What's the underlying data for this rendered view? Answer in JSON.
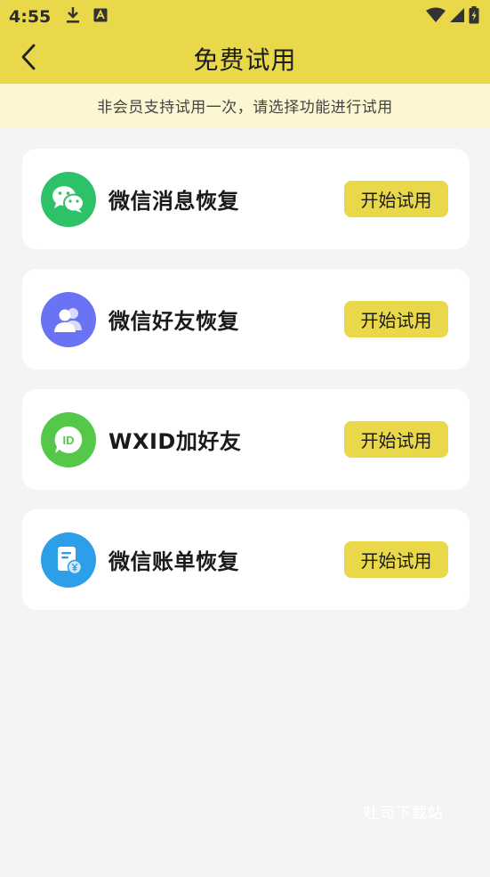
{
  "status_bar": {
    "time": "4:55",
    "icons_left": [
      "download-icon",
      "app-a-icon"
    ],
    "icons_right": [
      "wifi-icon",
      "signal-icon",
      "battery-icon"
    ]
  },
  "header": {
    "title": "免费试用",
    "back_icon": "chevron-left-icon"
  },
  "notice": "非会员支持试用一次，请选择功能进行试用",
  "features": [
    {
      "label": "微信消息恢复",
      "button": "开始试用",
      "icon": "wechat-icon",
      "color": "#2dc168"
    },
    {
      "label": "微信好友恢复",
      "button": "开始试用",
      "icon": "contacts-icon",
      "color": "#6b73f5"
    },
    {
      "label": "WXID加好友",
      "button": "开始试用",
      "icon": "id-bubble-icon",
      "color": "#55c84a"
    },
    {
      "label": "微信账单恢复",
      "button": "开始试用",
      "icon": "bill-icon",
      "color": "#2d9ee8"
    }
  ],
  "watermark": "吐司下载站",
  "colors": {
    "accent": "#e9d84a",
    "notice_bg": "#fcf7d2",
    "page_bg": "#f4f4f4"
  }
}
